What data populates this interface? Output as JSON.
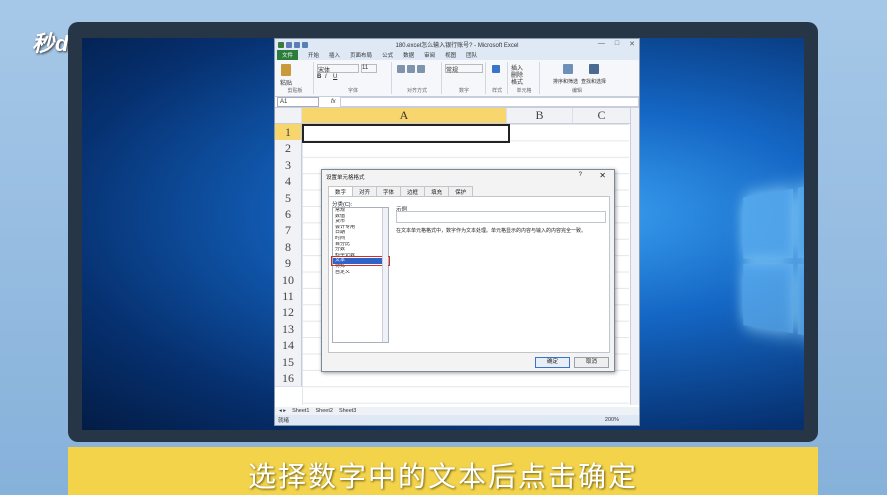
{
  "brand": {
    "logo_text": "秒dong视频"
  },
  "caption": "选择数字中的文本后点击确定",
  "excel": {
    "title": "180.excel怎么输入银行账号? - Microsoft Excel",
    "tabs": [
      "文件",
      "开始",
      "插入",
      "页面布局",
      "公式",
      "数据",
      "审阅",
      "视图",
      "团队"
    ],
    "ribbon_groups": [
      "剪贴板",
      "字体",
      "对齐方式",
      "数字",
      "样式",
      "单元格",
      "编辑"
    ],
    "font_name": "宋体",
    "font_size": "11",
    "number_format": "常规",
    "cells_buttons": [
      "插入",
      "删除",
      "格式"
    ],
    "sort_label": "排序和筛选",
    "find_label": "查找和选择",
    "paste_label": "粘贴",
    "name_box": "A1",
    "fx_label": "fx",
    "columns": [
      "A",
      "B",
      "C"
    ],
    "rows": [
      "1",
      "2",
      "3",
      "4",
      "5",
      "6",
      "7",
      "8",
      "9",
      "10",
      "11",
      "12",
      "13",
      "14",
      "15",
      "16"
    ],
    "sheets": [
      "Sheet1",
      "Sheet2",
      "Sheet3"
    ],
    "status": "就绪",
    "zoom": "200%"
  },
  "dialog": {
    "title": "设置单元格格式",
    "help": "?",
    "close": "✕",
    "tabs": [
      "数字",
      "对齐",
      "字体",
      "边框",
      "填充",
      "保护"
    ],
    "category_label": "分类(C):",
    "categories": [
      "常规",
      "数值",
      "货币",
      "会计专用",
      "日期",
      "时间",
      "百分比",
      "分数",
      "科学记数",
      "文本",
      "特殊",
      "自定义"
    ],
    "selected_index": 9,
    "sample_label": "示例",
    "description": "在文本单元格格式中，数字作为文本处理。单元格显示的内容与输入的内容完全一致。",
    "ok_label": "确定",
    "cancel_label": "取消"
  }
}
